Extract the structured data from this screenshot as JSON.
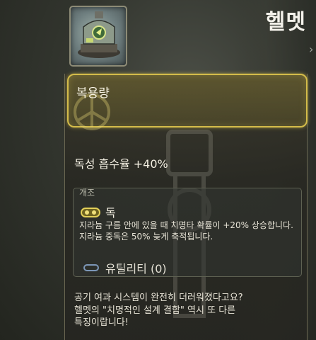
{
  "item": {
    "name": "헬멧",
    "header_label": "복용량",
    "stat_text": "독성 흡수율 +40%"
  },
  "modification": {
    "section_title": "개조",
    "poison": {
      "name": "독",
      "description": "지라늄 구름 안에 있을 때 치명타 확률이 +20% 상승합니다. 지라늄 중독은 50% 늦게 축적됩니다."
    },
    "utility": {
      "label": "유틸리티 (0)"
    }
  },
  "flavor_text": [
    "공기 여과 시스템이 완전히 더러워졌다고요?",
    "헬멧의 \"치명적인 설계 결함\" 역시 또 다른",
    "특징이랍니다!"
  ],
  "colors": {
    "accent_gold": "#d4bc4a",
    "utility_blue": "#7c97b7"
  }
}
